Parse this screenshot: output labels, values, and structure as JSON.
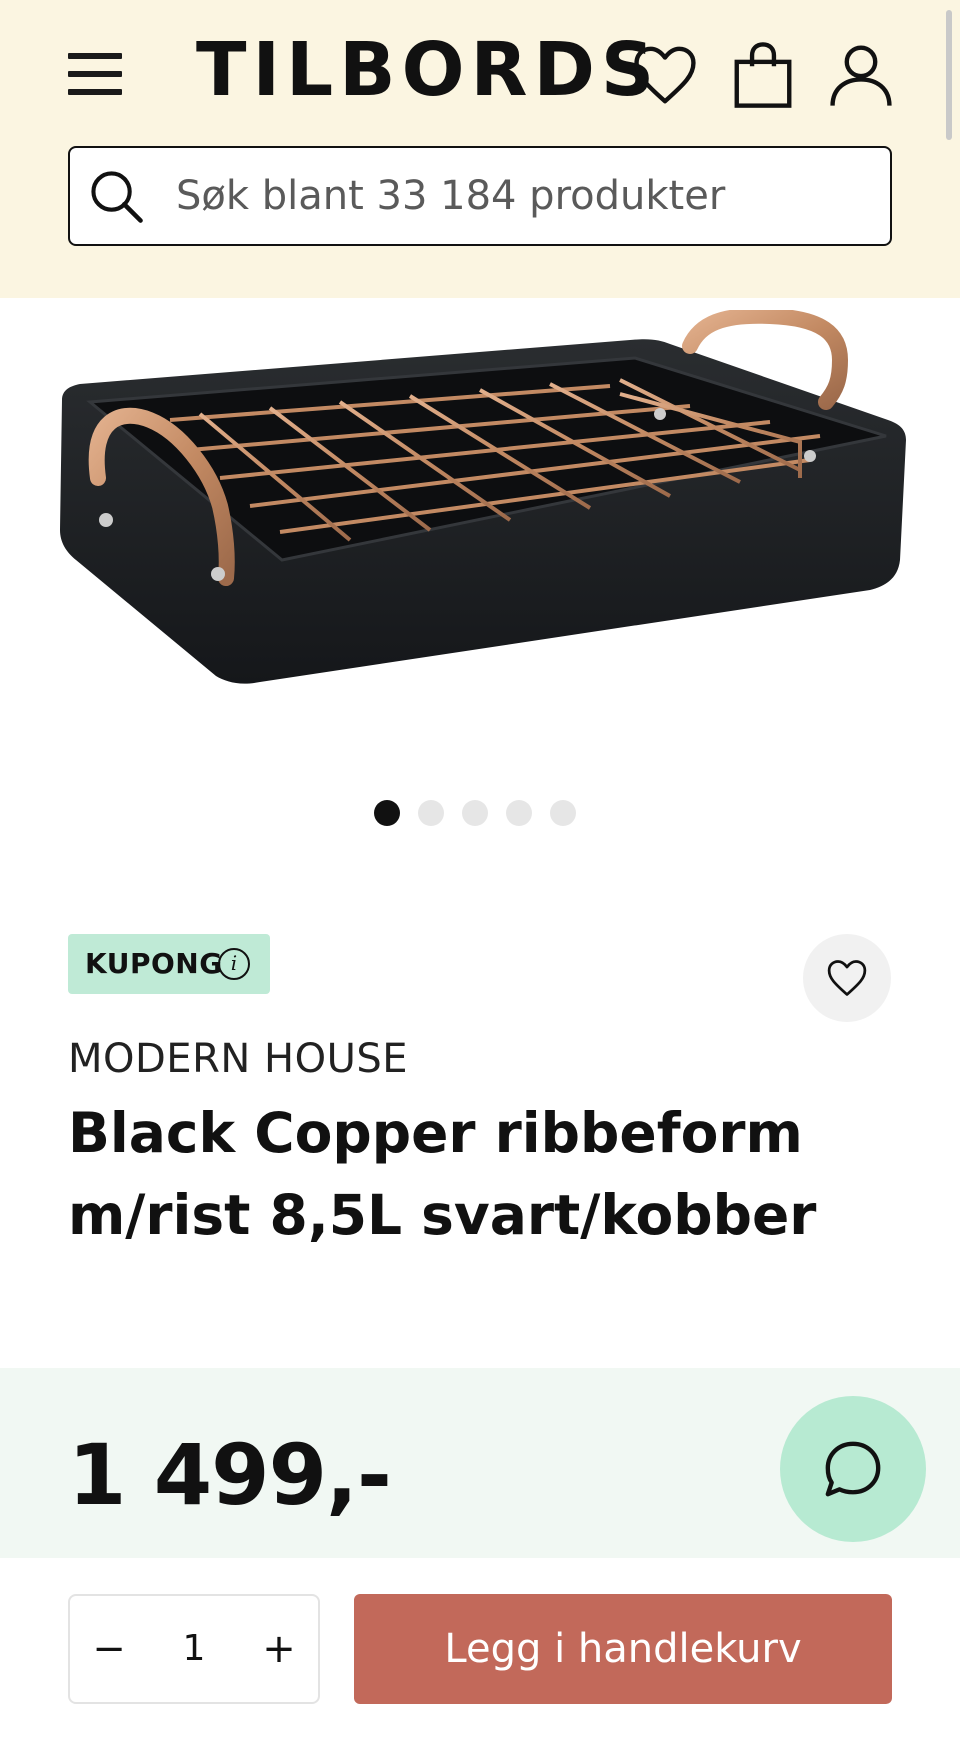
{
  "header": {
    "logo_text": "TILBORDS",
    "search": {
      "placeholder": "Søk blant 33 184 produkter"
    },
    "icons": [
      "menu-icon",
      "heart-icon",
      "shopping-bag-icon",
      "user-icon",
      "search-icon"
    ],
    "background_color": "#fbf5e1"
  },
  "gallery": {
    "image_description_icon": "roasting-pan-image",
    "total_images": 5,
    "active_index": 0
  },
  "product": {
    "badge": {
      "label": "KUPONG",
      "info_icon": "info-icon",
      "color": "#bfead6"
    },
    "brand": "MODERN HOUSE",
    "title": "Black Copper ribbeform m/rist 8,5L svart/kobber",
    "price": "1 499,-"
  },
  "purchase": {
    "quantity": "1",
    "minus_label": "−",
    "plus_label": "+",
    "add_to_cart_label": "Legg i handlekurv",
    "button_color": "#c2695a"
  },
  "chat": {
    "icon": "chat-bubble-icon",
    "color": "#b7ead2"
  }
}
